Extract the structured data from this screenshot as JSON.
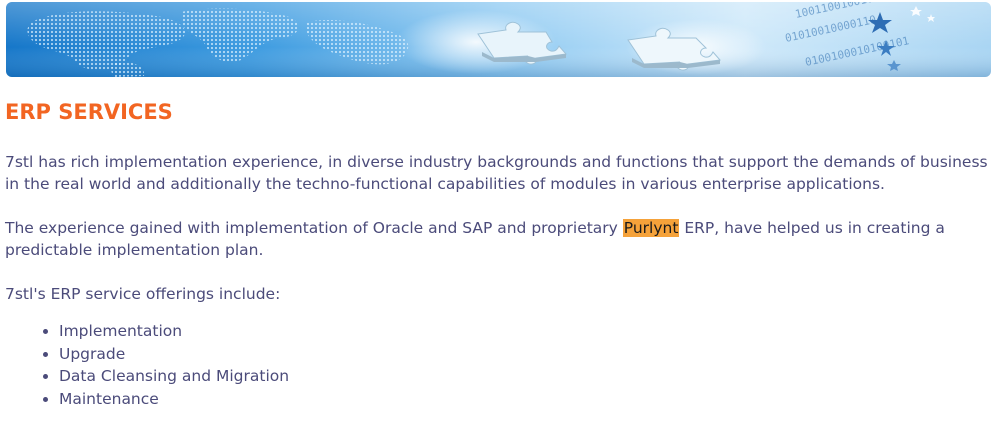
{
  "page": {
    "title": "ERP SERVICES",
    "colors": {
      "title": "#f26522",
      "text": "#4b4b7a",
      "highlight": "#f5a23a"
    }
  },
  "banner": {
    "icons": [
      "world-map-graphic",
      "puzzle-piece-icon",
      "star-icon"
    ],
    "binary_text": "1001100100101 01010010000110 0100100010100101"
  },
  "content": {
    "p1": "7stl has rich implementation experience, in diverse industry backgrounds and functions that support the demands of business in the real world and additionally the techno-functional capabilities of modules in various enterprise applications.",
    "p2_before": "The experience gained with implementation of Oracle and SAP and proprietary ",
    "p2_highlight": "Purlynt",
    "p2_after": " ERP, have helped us in creating a predictable implementation plan.",
    "p3": "7stl's ERP service offerings include:",
    "offerings": [
      "Implementation",
      "Upgrade",
      "Data Cleansing and Migration",
      "Maintenance"
    ]
  }
}
